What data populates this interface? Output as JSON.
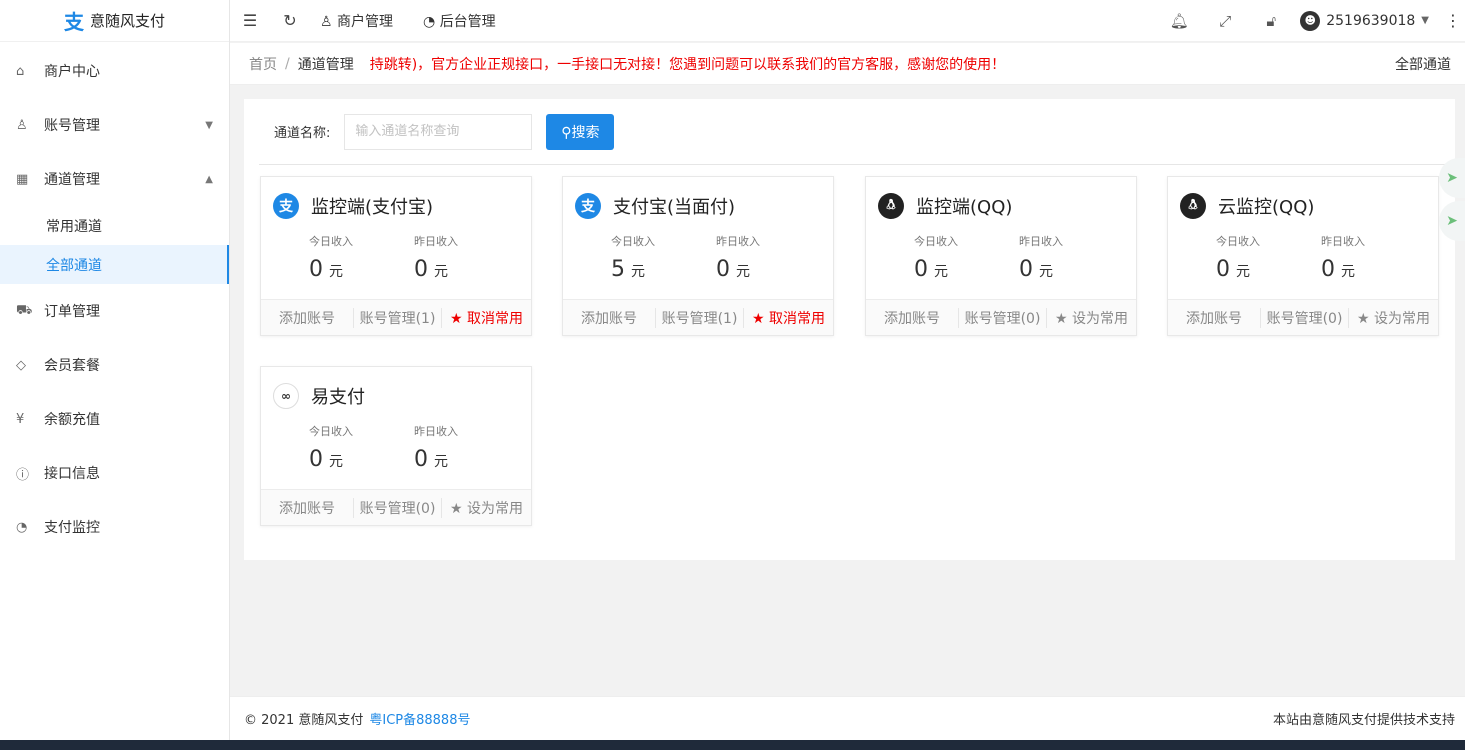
{
  "app": {
    "logo_glyph": "支",
    "title": "意随风支付"
  },
  "sidebar": {
    "items": [
      {
        "icon": "home-icon",
        "glyph": "⌂",
        "label": "商户中心"
      },
      {
        "icon": "user-icon",
        "glyph": "♙",
        "label": "账号管理"
      },
      {
        "icon": "apps-icon",
        "glyph": "▦",
        "label": "通道管理"
      },
      {
        "icon": "cart-icon",
        "glyph": "⛟",
        "label": "订单管理"
      },
      {
        "icon": "diamond-icon",
        "glyph": "◇",
        "label": "会员套餐"
      },
      {
        "icon": "yen-icon",
        "glyph": "¥",
        "label": "余额充值"
      },
      {
        "icon": "info-icon",
        "glyph": "ⓘ",
        "label": "接口信息"
      },
      {
        "icon": "dashboard-icon",
        "glyph": "◔",
        "label": "支付监控"
      }
    ],
    "sub": [
      {
        "label": "常用通道"
      },
      {
        "label": "全部通道"
      }
    ]
  },
  "topbar": {
    "links": [
      {
        "label": "商户管理"
      },
      {
        "label": "后台管理"
      }
    ],
    "username": "2519639018"
  },
  "breadcrumb": {
    "home": "首页",
    "sep": "/",
    "current": "通道管理",
    "notice": "持跳转)，官方企业正规接口，一手接口无对接！您遇到问题可以联系我们的官方客服，感谢您的使用！",
    "right": "全部通道"
  },
  "search": {
    "label": "通道名称:",
    "placeholder": "输入通道名称查询",
    "button": "搜索"
  },
  "colors": {
    "accent": "#1e88e5",
    "danger": "#ee0000",
    "alipay": "#1e88e5"
  },
  "cards": [
    {
      "name": "监控端(支付宝)",
      "icon": "alipay-icon",
      "today_label": "今日收入",
      "today": "0",
      "yest_label": "昨日收入",
      "yest": "0",
      "unit": "元",
      "add": "添加账号",
      "manage": "账号管理(1)",
      "fav": "取消常用",
      "fav_on": true
    },
    {
      "name": "支付宝(当面付)",
      "icon": "alipay-icon",
      "today_label": "今日收入",
      "today": "5",
      "yest_label": "昨日收入",
      "yest": "0",
      "unit": "元",
      "add": "添加账号",
      "manage": "账号管理(1)",
      "fav": "取消常用",
      "fav_on": true
    },
    {
      "name": "监控端(QQ)",
      "icon": "qq-icon",
      "today_label": "今日收入",
      "today": "0",
      "yest_label": "昨日收入",
      "yest": "0",
      "unit": "元",
      "add": "添加账号",
      "manage": "账号管理(0)",
      "fav": "设为常用",
      "fav_on": false
    },
    {
      "name": "云监控(QQ)",
      "icon": "qq-icon",
      "today_label": "今日收入",
      "today": "0",
      "yest_label": "昨日收入",
      "yest": "0",
      "unit": "元",
      "add": "添加账号",
      "manage": "账号管理(0)",
      "fav": "设为常用",
      "fav_on": false
    },
    {
      "name": "易支付",
      "icon": "epay-icon",
      "today_label": "今日收入",
      "today": "0",
      "yest_label": "昨日收入",
      "yest": "0",
      "unit": "元",
      "add": "添加账号",
      "manage": "账号管理(0)",
      "fav": "设为常用",
      "fav_on": false
    }
  ],
  "footer": {
    "copyright": "© 2021 意随风支付",
    "icp": "粤ICP备88888号",
    "support": "本站由意随风支付提供技术支持"
  }
}
